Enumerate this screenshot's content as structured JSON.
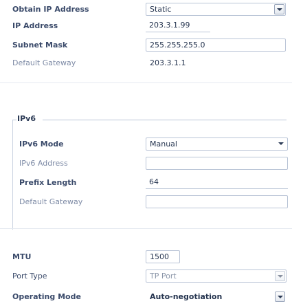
{
  "ipv4": {
    "obtain_label": "Obtain IP Address",
    "obtain_value": "Static",
    "ip_label": "IP Address",
    "ip_value": "203.3.1.99",
    "mask_label": "Subnet Mask",
    "mask_value": "255.255.255.0",
    "gateway_label": "Default Gateway",
    "gateway_value": "203.3.1.1"
  },
  "ipv6": {
    "group_title": "IPv6",
    "mode_label": "IPv6 Mode",
    "mode_value": "Manual",
    "address_label": "IPv6 Address",
    "address_value": "",
    "prefix_label": "Prefix Length",
    "prefix_value": "64",
    "gateway_label": "Default Gateway",
    "gateway_value": ""
  },
  "port": {
    "mtu_label": "MTU",
    "mtu_value": "1500",
    "type_label": "Port Type",
    "type_value": "TP Port",
    "mode_label": "Operating Mode",
    "mode_value": "Auto-negotiation"
  }
}
